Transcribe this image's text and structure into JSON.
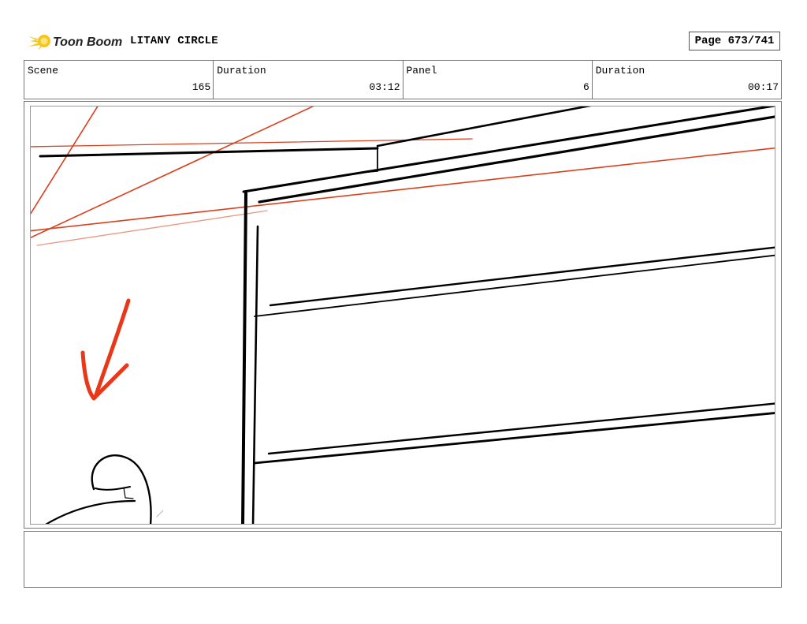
{
  "header": {
    "logo_text": "Toon Boom",
    "project_title": "LITANY CIRCLE",
    "page_label": "Page 673/741"
  },
  "info": {
    "scene_label": "Scene",
    "scene_value": "165",
    "duration_label": "Duration",
    "duration_value": "03:12",
    "panel_label": "Panel",
    "panel_value": "6",
    "panel_duration_label": "Duration",
    "panel_duration_value": "00:17"
  },
  "colors": {
    "logo_yellow": "#f5c518",
    "sketch_black": "#000000",
    "sketch_red": "#d8401e",
    "arrow_red": "#e8381a"
  },
  "icons": {
    "logo": "toon-boom-comet-icon"
  },
  "notes": {
    "text": ""
  }
}
